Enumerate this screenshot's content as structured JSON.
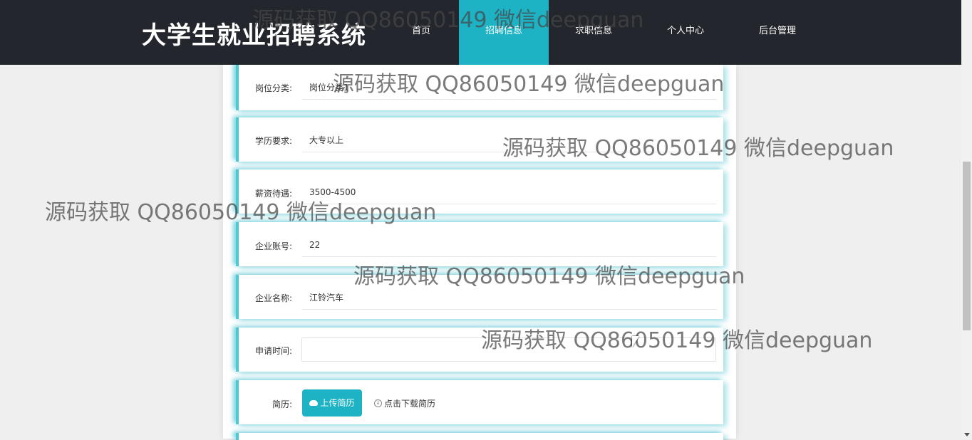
{
  "header": {
    "site_title": "大学生就业招聘系统",
    "nav": [
      {
        "label": "首页",
        "active": false
      },
      {
        "label": "招聘信息",
        "active": true
      },
      {
        "label": "求职信息",
        "active": false
      },
      {
        "label": "个人中心",
        "active": false
      },
      {
        "label": "后台管理",
        "active": false
      }
    ],
    "accent_color": "#1db3c4",
    "background_color": "#23262d"
  },
  "form": {
    "fields": [
      {
        "label": "岗位分类:",
        "value": "岗位分类1"
      },
      {
        "label": "学历要求:",
        "value": "大专以上"
      },
      {
        "label": "薪资待遇:",
        "value": "3500-4500"
      },
      {
        "label": "企业账号:",
        "value": "22"
      },
      {
        "label": "企业名称:",
        "value": "江铃汽车"
      },
      {
        "label": "申请时间:",
        "value": ""
      }
    ],
    "resume": {
      "label": "简历:",
      "upload_button": "上传简历",
      "upload_icon": "cloud-upload-icon",
      "download_link": "点击下载简历",
      "download_icon": "download-circle-icon"
    }
  },
  "watermark_text": "源码获取 QQ86050149 微信deepguan"
}
